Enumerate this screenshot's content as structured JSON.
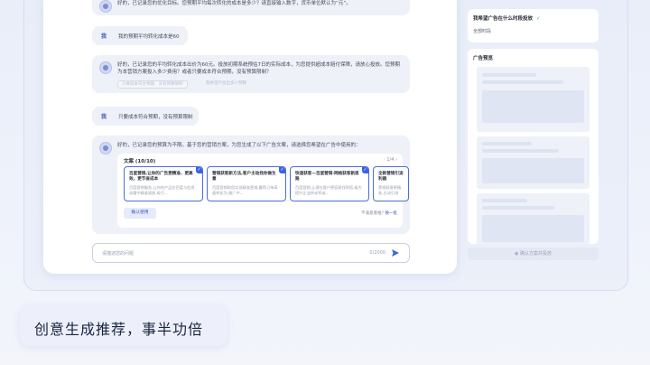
{
  "chat": {
    "m1": "好的，已记录您的优化目标。您预期平均每次转化的成本是多少？请直接输入数字，货币单位默认为“元”。",
    "u1": {
      "tag": "我",
      "text": "我的预期平均转化成本是60"
    },
    "m2": "好的，已记录您的平均转化成本出价为60元。投放初期系统预估7日的实际成本，为您提供超成本赔付保障，请放心投放。您预期为本营销方案投入多少费用？或者只要成本符合预期，没有预算限制？",
    "chips": [
      "只要成本符合预期，没有预算限制",
      "我希望产投出多少预算"
    ],
    "u2": {
      "tag": "我",
      "text": "只要成本符合预期，没有预算限制"
    },
    "m3": "好的，已记录您的预算为不限。基于您的营销方案，为您生成了以下广告文案，请选择您希望在广告中使用的：",
    "copy": {
      "title": "文案 (10/10)",
      "pager": "1/4",
      "cards": [
        {
          "title": "百度营销,让你的广告更精准、更高效，更节省成本",
          "body": "百度营销服务,让你的产品在百度与信息流量中精准投放,吸引..."
        },
        {
          "title": "营销获客新方法,客户主动找你做生意",
          "body": "百度营销助您实现精准营销,赢得订单高速转化为,推广中..."
        },
        {
          "title": "快速获客—百度营销·网络获客新思路",
          "body": "百度营销,让潜在客户更容易找到您,极大提升企业转化率或..."
        },
        {
          "title": "全新营销引流利器",
          "body": "营销获客更精准,主动引流"
        }
      ],
      "confirm": "确认使用",
      "unsatisfied": "不满意重推?",
      "swap": "换一批"
    },
    "input": {
      "placeholder": "请描述您的问题",
      "count": "0/2000"
    }
  },
  "sidebar": {
    "question": "我希望广告在什么时段投放",
    "answer": "全部时段",
    "preview_title": "广告预览",
    "confirm_push": "确认方案并投放"
  },
  "slogan": "创意生成推荐，事半功倍",
  "colors": {
    "accent": "#3b63e0",
    "check": "#3bb36a"
  }
}
